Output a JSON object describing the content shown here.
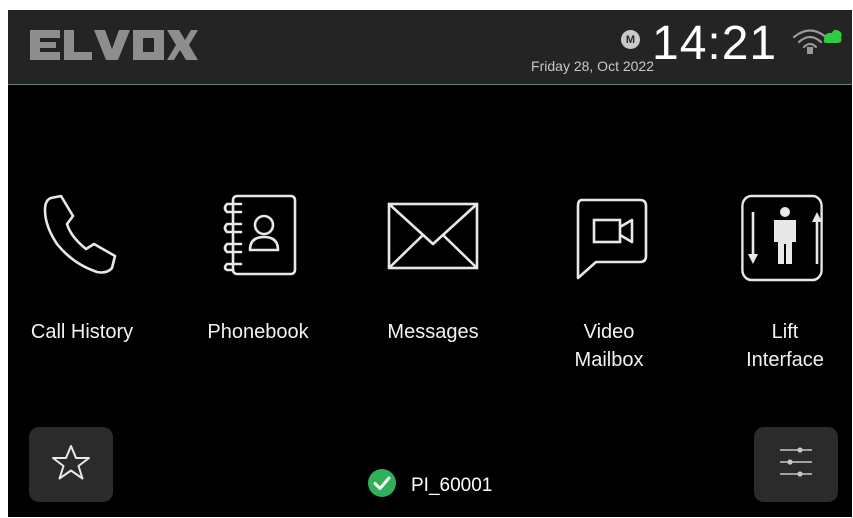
{
  "header": {
    "brand": "ELVOX",
    "date": "Friday 28, Oct 2022",
    "mode_badge": "M",
    "time": "14:21",
    "network_icon": "wifi-cloud-icon",
    "network_color": "#2ecc40"
  },
  "apps": [
    {
      "label": "Call History",
      "icon": "phone-handset-icon"
    },
    {
      "label": "Phonebook",
      "icon": "address-book-icon"
    },
    {
      "label": "Messages",
      "icon": "envelope-icon"
    },
    {
      "label": "Video\nMailbox",
      "icon": "video-message-icon"
    },
    {
      "label": "Lift\nInterface",
      "icon": "lift-icon"
    }
  ],
  "footer": {
    "favorites_icon": "star-icon",
    "settings_icon": "sliders-icon",
    "status_label": "PI_60001",
    "status_icon": "check-circle-icon",
    "status_color": "#2fb15a"
  }
}
